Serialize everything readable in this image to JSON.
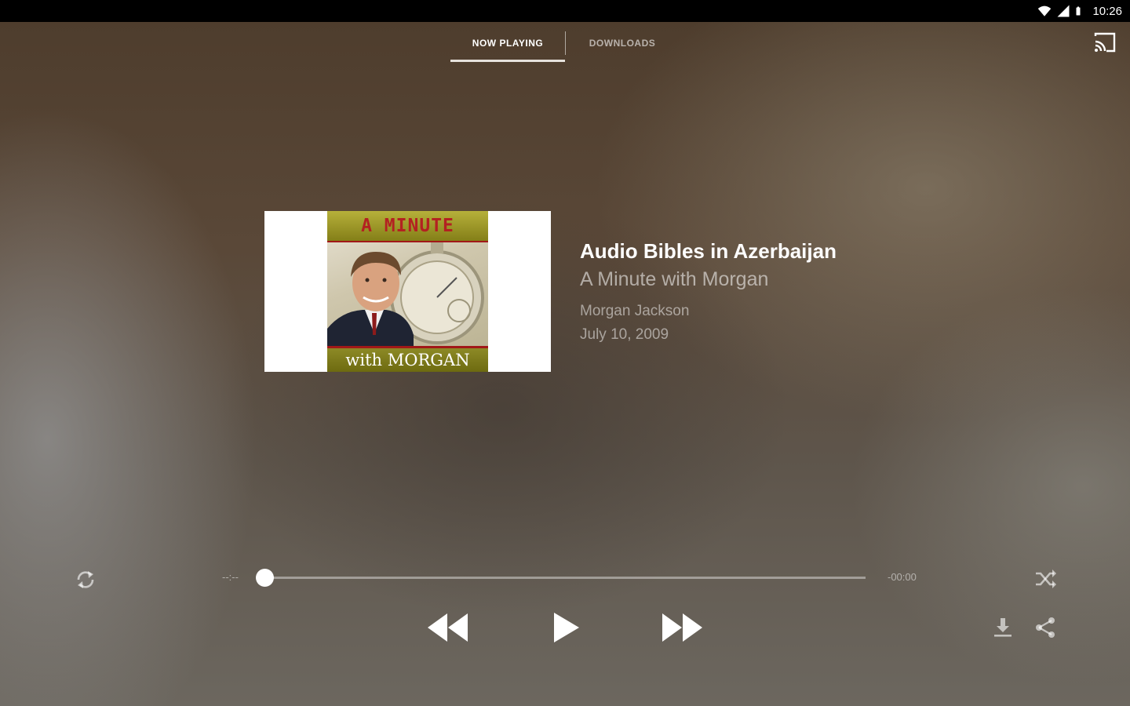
{
  "status_bar": {
    "time": "10:26",
    "icons": [
      "wifi-icon",
      "cell-signal-icon",
      "battery-icon"
    ]
  },
  "tabs": [
    {
      "label": "NOW PLAYING",
      "selected": true
    },
    {
      "label": "DOWNLOADS",
      "selected": false
    }
  ],
  "toolbar": {
    "cast_icon": "cast-icon"
  },
  "artwork": {
    "top_text": "A MINUTE",
    "bottom_text": "with MORGAN"
  },
  "episode": {
    "title": "Audio Bibles in Azerbaijan",
    "show": "A Minute with Morgan",
    "author": "Morgan Jackson",
    "date": "July 10, 2009"
  },
  "player": {
    "elapsed": "--:--",
    "remaining": "-00:00",
    "progress_fraction": 0,
    "controls": [
      "repeat-icon",
      "rewind-icon",
      "play-icon",
      "fast-forward-icon",
      "shuffle-icon",
      "download-icon",
      "share-icon"
    ]
  },
  "colors": {
    "status_bar": "#000000",
    "tab_indicator": "#e6e2dc",
    "artwork_banner": "#847f18",
    "artwork_accent": "#a11818"
  }
}
